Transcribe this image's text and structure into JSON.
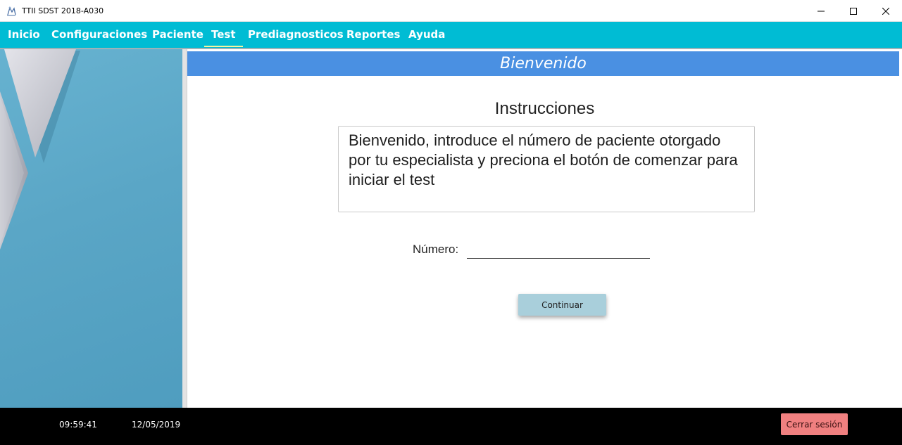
{
  "window": {
    "title": "TTII SDST 2018-A030"
  },
  "menu": {
    "items": [
      {
        "label": "Inicio"
      },
      {
        "label": "Configuraciones"
      },
      {
        "label": "Paciente"
      },
      {
        "label": "Test"
      },
      {
        "label": "Prediagnosticos"
      },
      {
        "label": "Reportes"
      },
      {
        "label": "Ayuda"
      }
    ],
    "active": "Test"
  },
  "header": {
    "title": "Bienvenido"
  },
  "instructions": {
    "title": "Instrucciones",
    "text": "Bienvenido, introduce el número de paciente otorgado por tu especialista y preciona el botón de comenzar para iniciar el test"
  },
  "form": {
    "numero_label": "Número:",
    "numero_value": "",
    "continue_label": "Continuar"
  },
  "footer": {
    "time": "09:59:41",
    "date": "12/05/2019",
    "logout_label": "Cerrar sesión"
  },
  "colors": {
    "menu_bar": "#00bcd4",
    "header_band": "#4a90e2",
    "continue_button": "#a9cfdb",
    "logout_button": "#f08080",
    "footer": "#000000",
    "side_panel": "#5aa6c6"
  },
  "icons": {
    "app": "app-logo-icon",
    "minimize": "minimize-icon",
    "maximize": "maximize-icon",
    "close": "close-icon"
  }
}
